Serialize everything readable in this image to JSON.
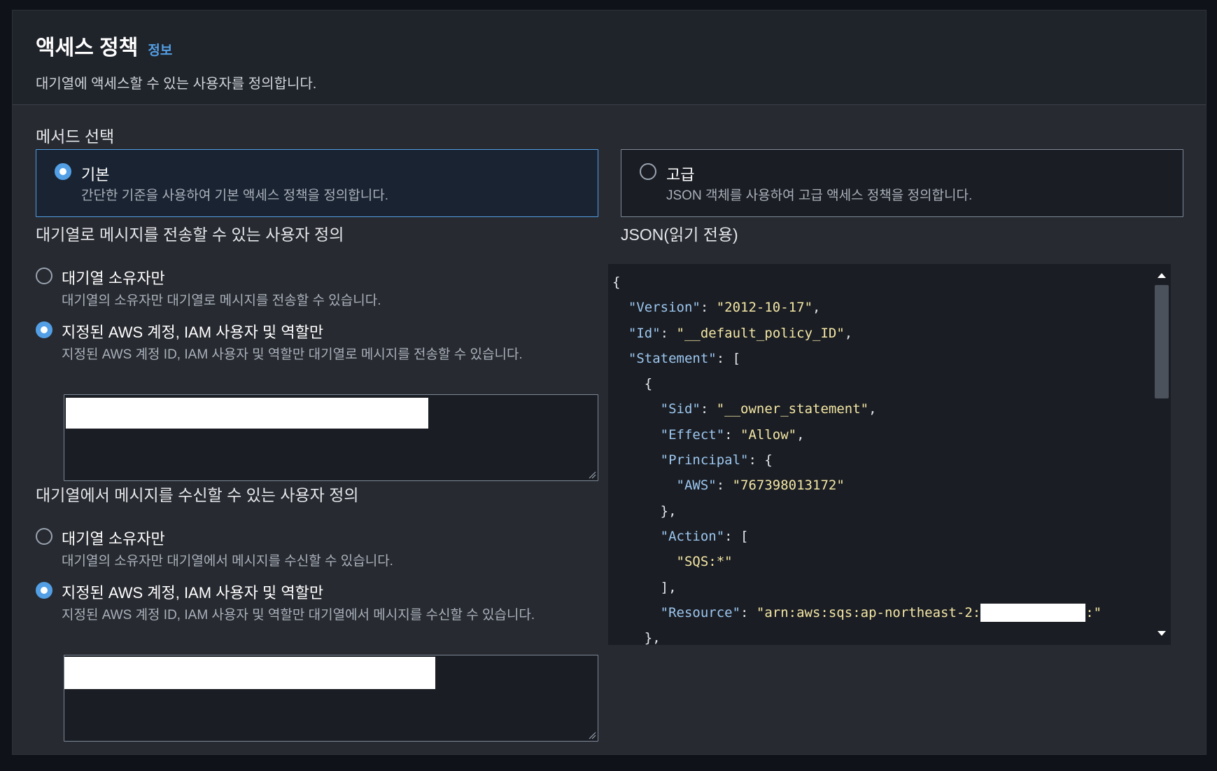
{
  "header": {
    "title": "액세스 정책",
    "info_link": "정보",
    "subtitle": "대기열에 액세스할 수 있는 사용자를 정의합니다."
  },
  "method": {
    "label": "메서드 선택",
    "options": [
      {
        "label": "기본",
        "description": "간단한 기준을 사용하여 기본 액세스 정책을 정의합니다.",
        "selected": true
      },
      {
        "label": "고급",
        "description": "JSON 객체를 사용하여 고급 액세스 정책을 정의합니다.",
        "selected": false
      }
    ]
  },
  "send": {
    "label": "대기열로 메시지를 전송할 수 있는 사용자 정의",
    "options": [
      {
        "label": "대기열 소유자만",
        "description": "대기열의 소유자만 대기열로 메시지를 전송할 수 있습니다.",
        "selected": false
      },
      {
        "label": "지정된 AWS 계정, IAM 사용자 및 역할만",
        "description": "지정된 AWS 계정 ID, IAM 사용자 및 역할만 대기열로 메시지를 전송할 수 있습니다.",
        "selected": true
      }
    ]
  },
  "receive": {
    "label": "대기열에서 메시지를 수신할 수 있는 사용자 정의",
    "options": [
      {
        "label": "대기열 소유자만",
        "description": "대기열의 소유자만 대기열에서 메시지를 수신할 수 있습니다.",
        "selected": false
      },
      {
        "label": "지정된 AWS 계정, IAM 사용자 및 역할만",
        "description": "지정된 AWS 계정 ID, IAM 사용자 및 역할만 대기열에서 메시지를 수신할 수 있습니다.",
        "selected": true
      }
    ]
  },
  "json": {
    "label": "JSON(읽기 전용)",
    "lines": [
      "{",
      "  \"Version\": \"2012-10-17\",",
      "  \"Id\": \"__default_policy_ID\",",
      "  \"Statement\": [",
      "    {",
      "      \"Sid\": \"__owner_statement\",",
      "      \"Effect\": \"Allow\",",
      "      \"Principal\": {",
      "        \"AWS\": \"767398013172\"",
      "      },",
      "      \"Action\": [",
      "        \"SQS:*\"",
      "      ],",
      "      \"Resource\": \"arn:aws:sqs:ap-northeast-2:[REDACTED]:\"",
      "    },"
    ]
  },
  "colors": {
    "accent": "#539fe5",
    "background": "#272a30",
    "json_key": "#9cc7f0",
    "json_string": "#f4e7a5"
  }
}
